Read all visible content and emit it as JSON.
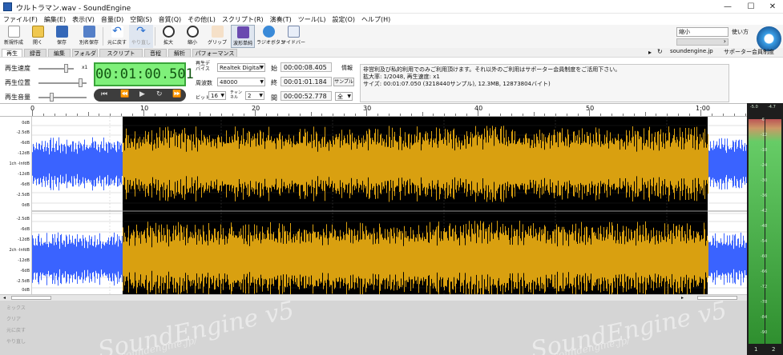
{
  "window": {
    "title": "ウルトラマン.wav - SoundEngine",
    "minimize": "—",
    "maximize": "☐",
    "close": "✕"
  },
  "menu": [
    "ファイル(F)",
    "編集(E)",
    "表示(V)",
    "音量(D)",
    "空間(S)",
    "音質(Q)",
    "その他(L)",
    "スクリプト(R)",
    "演奏(T)",
    "ツール(L)",
    "設定(O)",
    "ヘルプ(H)"
  ],
  "toolbar": [
    {
      "label": "新規作成",
      "icon": "new-file-icon"
    },
    {
      "label": "開く",
      "icon": "open-folder-icon"
    },
    {
      "label": "保存",
      "icon": "save-icon"
    },
    {
      "label": "別名保存",
      "icon": "save-as-icon"
    },
    {
      "label": "元に戻す",
      "icon": "undo-icon"
    },
    {
      "label": "やり直し",
      "icon": "redo-icon"
    },
    {
      "label": "拡大",
      "icon": "zoom-in-icon"
    },
    {
      "label": "縮小",
      "icon": "zoom-out-icon"
    },
    {
      "label": "グリップ",
      "icon": "grip-icon"
    },
    {
      "label": "波形単純",
      "icon": "waveform-icon"
    },
    {
      "label": "ラジオボタン",
      "icon": "radial-icon"
    },
    {
      "label": "サイドバー",
      "icon": "sidebar-icon"
    }
  ],
  "right_panel": {
    "dropdown_value": "縮小",
    "howto": "使い方",
    "arrow": "›"
  },
  "tabs": [
    "再生",
    "録音",
    "編集",
    "フォルダ",
    "スクリプト",
    "音程",
    "解析",
    "パフォーマンス"
  ],
  "active_tab": "再生",
  "top_right": {
    "arrow": "▸",
    "refresh": "↻",
    "site": "soundengine.jp",
    "support": "サポーター会員制度"
  },
  "play": {
    "speed_label": "再生速度",
    "speed_value": "x1",
    "position_label": "再生位置",
    "volume_label": "再生音量",
    "time": "00:01:00.501",
    "device_label": "再生デバイス",
    "device": "Realtek Digital",
    "freq_label": "周波数",
    "freq": "48000",
    "bit_label": "ビット",
    "bit": "16",
    "channel_label": "チャンネル",
    "channel": "2",
    "start_label": "始",
    "start": "00:00:08.405",
    "end_label": "終",
    "end": "00:01:01.184",
    "interval_label": "間",
    "interval": "00:00:52.778",
    "sample_button": "サンプル",
    "all_option": "全",
    "info_label": "情報",
    "info_lines": [
      "非営利及び私的利用でのみご利用頂けます。それ以外のご利用はサポーター会員制度をご活用下さい。",
      "拡大率: 1/2048, 再生速度: x1",
      "サイズ: 00:01:07.050 (3218440サンプル), 12.3MB, 12873804バイト)"
    ]
  },
  "ruler": [
    "0",
    "10",
    "20",
    "30",
    "40",
    "50",
    "1:00"
  ],
  "db_labels_ch1": [
    "0dB",
    "-2.5dB",
    "-6dB",
    "-12dB",
    "1ch -InfdB",
    "-12dB",
    "-6dB",
    "-2.5dB",
    "0dB"
  ],
  "db_labels_ch2": [
    "-2.5dB",
    "-6dB",
    "-12dB",
    "2ch -InfdB",
    "-12dB",
    "-6dB",
    "-2.5dB",
    "0dB"
  ],
  "meter": {
    "top": [
      "-5.0",
      "-4.7"
    ],
    "scale": [
      "6",
      "12",
      "18",
      "24",
      "30",
      "36",
      "42",
      "48",
      "54",
      "60",
      "66",
      "72",
      "78",
      "84",
      "90"
    ],
    "channels": [
      "1",
      "2"
    ],
    "levels": [
      0.97,
      0.97
    ]
  },
  "sidebar_bottom": [
    "ミックス",
    "クリア",
    "元に戻す",
    "やり直し"
  ],
  "watermark": {
    "title": "SoundEngine v5",
    "url": "soundengine.jp/"
  },
  "colors": {
    "wave_unselected": "#3a63ff",
    "wave_selected": "#d9a010",
    "selection_bg": "#000000",
    "timer_bg": "#7ff07a"
  }
}
